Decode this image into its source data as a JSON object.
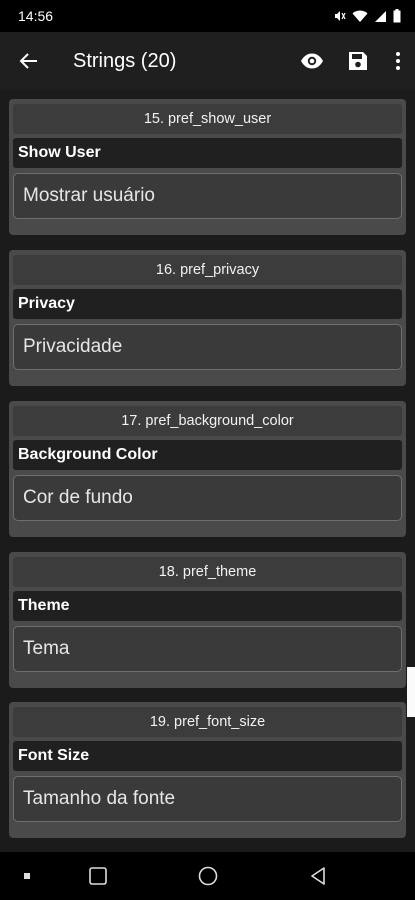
{
  "status_bar": {
    "time": "14:56"
  },
  "app_bar": {
    "title": "Strings (20)"
  },
  "cards": [
    {
      "key": "15. pref_show_user",
      "source": "Show User",
      "translation": "Mostrar usuário"
    },
    {
      "key": "16. pref_privacy",
      "source": "Privacy",
      "translation": "Privacidade"
    },
    {
      "key": "17. pref_background_color",
      "source": "Background Color",
      "translation": "Cor de fundo"
    },
    {
      "key": "18. pref_theme",
      "source": "Theme",
      "translation": "Tema"
    },
    {
      "key": "19. pref_font_size",
      "source": "Font Size",
      "translation": "Tamanho da fonte"
    }
  ],
  "icons": {
    "back": "arrow-back-icon",
    "preview": "eye-icon",
    "save": "save-icon",
    "more": "more-vert-icon",
    "mute": "mute-icon",
    "wifi": "wifi-icon",
    "signal": "signal-icon",
    "battery": "battery-icon",
    "nav_dot": "dot-icon",
    "nav_recents": "square-icon",
    "nav_home": "circle-icon",
    "nav_back": "triangle-back-icon"
  },
  "colors": {
    "background": "#1b1b1b",
    "card": "#4a4a4a",
    "source_row": "#202020",
    "app_bar": "#1f1f1f"
  }
}
